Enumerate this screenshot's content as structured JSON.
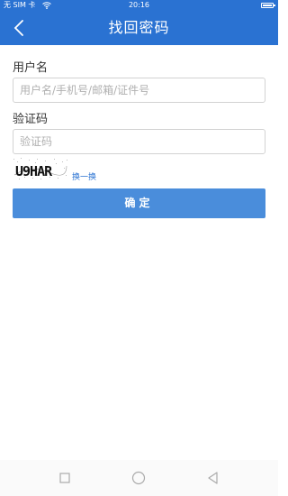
{
  "status_bar": {
    "carrier": "无 SIM 卡",
    "time": "20:16"
  },
  "header": {
    "title": "找回密码"
  },
  "form": {
    "username_label": "用户名",
    "username_placeholder": "用户名/手机号/邮箱/证件号",
    "captcha_label": "验证码",
    "captcha_placeholder": "验证码",
    "captcha_image_text": "U9HAR",
    "refresh_label": "换一换",
    "confirm_label": "确定"
  },
  "colors": {
    "primary": "#2a72d2",
    "button": "#4a8ddb",
    "link": "#2a72d2"
  },
  "icons": {
    "back": "chevron-left-icon",
    "wifi": "wifi-icon",
    "battery": "battery-icon",
    "nav_recent": "square-icon",
    "nav_home": "circle-icon",
    "nav_back": "triangle-left-icon"
  }
}
